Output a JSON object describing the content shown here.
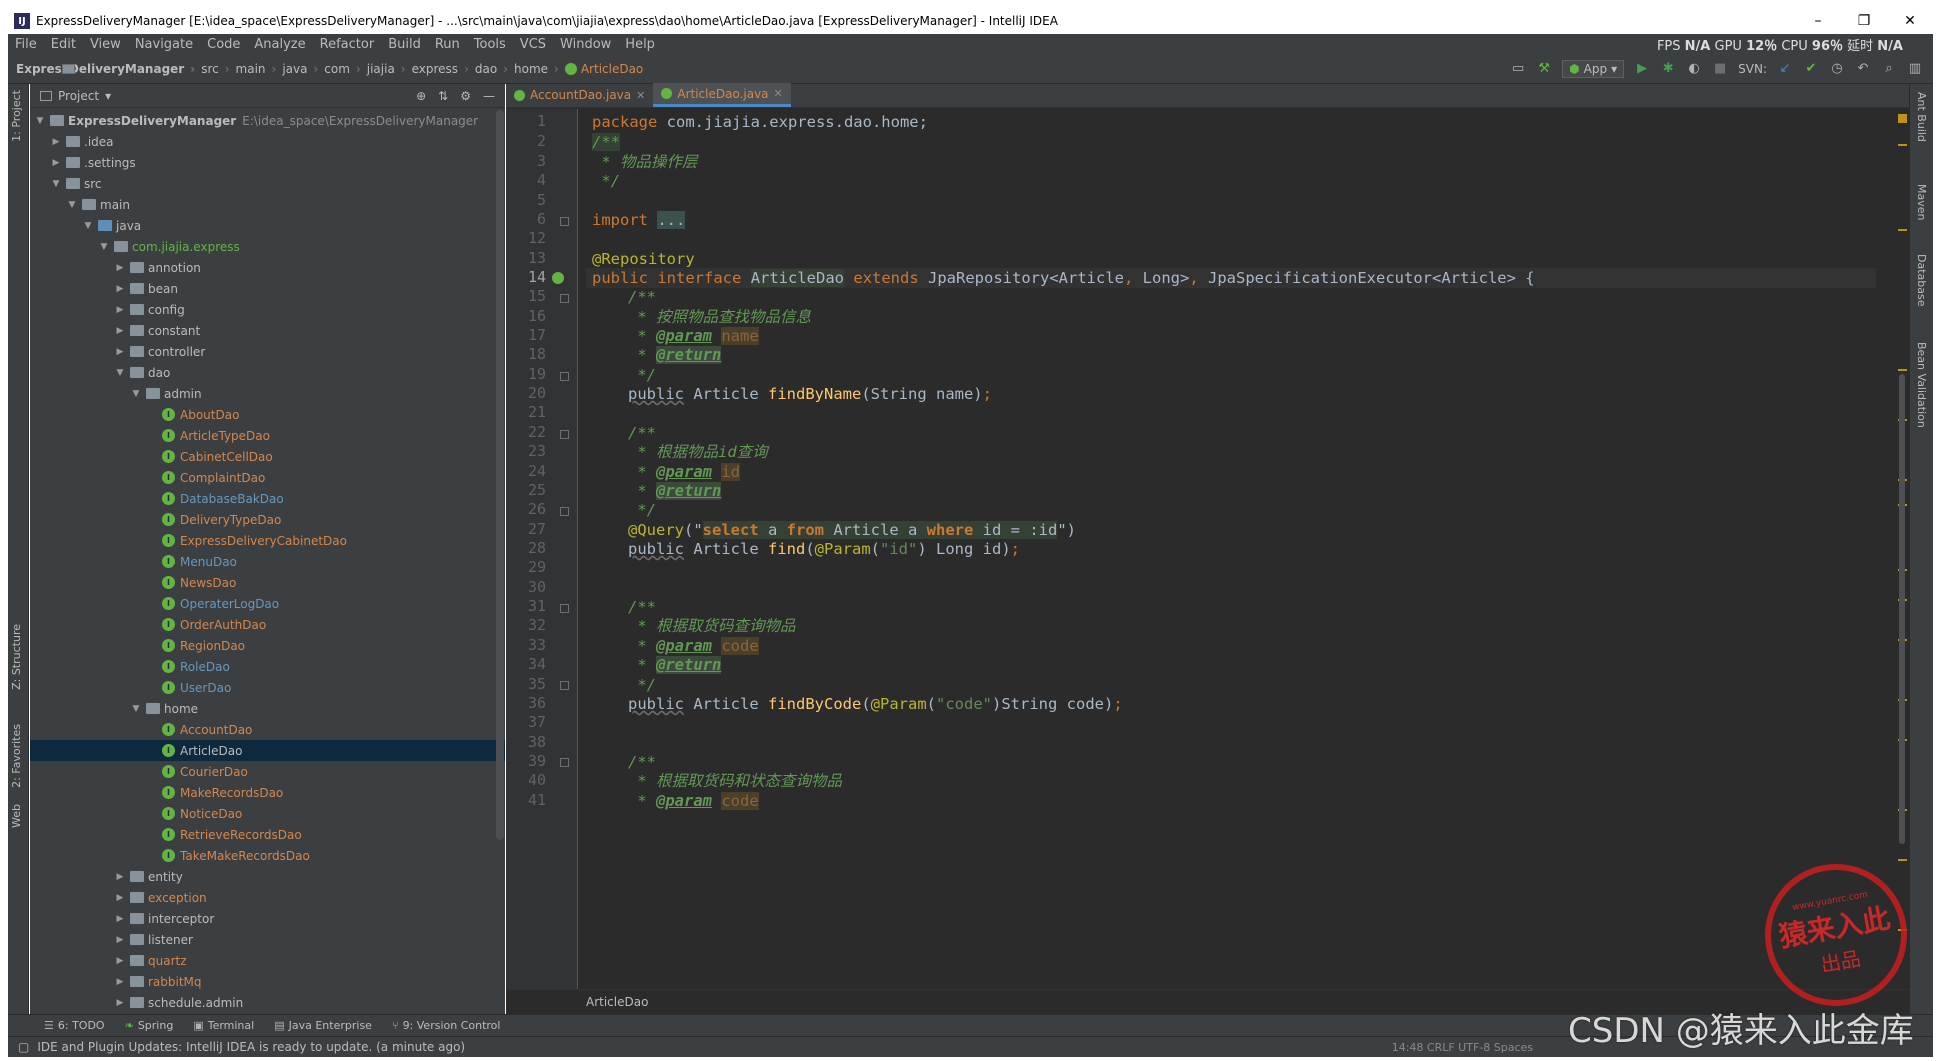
{
  "window": {
    "title": "ExpressDeliveryManager [E:\\idea_space\\ExpressDeliveryManager] - ...\\src\\main\\java\\com\\jiajia\\express\\dao\\home\\ArticleDao.java [ExpressDeliveryManager] - IntelliJ IDEA",
    "minimize": "–",
    "maximize": "❐",
    "close": "✕"
  },
  "menu": {
    "items": [
      "File",
      "Edit",
      "View",
      "Navigate",
      "Code",
      "Analyze",
      "Refactor",
      "Build",
      "Run",
      "Tools",
      "VCS",
      "Window",
      "Help"
    ],
    "perf": {
      "fps_label": "FPS",
      "fps": "N/A",
      "gpu_label": "GPU",
      "gpu": "12％",
      "cpu_label": "CPU",
      "cpu": "96％",
      "lat_label": "延时",
      "lat": "N/A"
    }
  },
  "breadcrumb": {
    "items": [
      "ExpressDeliveryManager",
      "src",
      "main",
      "java",
      "com",
      "jiajia",
      "express",
      "dao",
      "home"
    ],
    "file": "ArticleDao",
    "run_config": "App",
    "svn_label": "SVN:"
  },
  "left_strip": {
    "project": "1: Project",
    "structure": "Z: Structure",
    "favorites": "2: Favorites",
    "web": "Web"
  },
  "right_strip": {
    "ant": "Ant Build",
    "maven": "Maven",
    "database": "Database",
    "bean": "Bean Validation"
  },
  "project_panel": {
    "title": "Project",
    "root_name": "ExpressDeliveryManager",
    "root_path": "E:\\idea_space\\ExpressDeliveryManager",
    "nodes": {
      "idea": ".idea",
      "settings": ".settings",
      "src": "src",
      "main": "main",
      "java": "java",
      "pkg": "com.jiajia.express",
      "annotion": "annotion",
      "bean": "bean",
      "config": "config",
      "constant": "constant",
      "controller": "controller",
      "dao": "dao",
      "admin": "admin",
      "home": "home",
      "entity": "entity",
      "exception": "exception",
      "interceptor": "interceptor",
      "listener": "listener",
      "quartz": "quartz",
      "rabbitMq": "rabbitMq",
      "schedule": "schedule.admin"
    },
    "admin_classes": [
      {
        "name": "AboutDao",
        "color": "orange"
      },
      {
        "name": "ArticleTypeDao",
        "color": "orange"
      },
      {
        "name": "CabinetCellDao",
        "color": "orange"
      },
      {
        "name": "ComplaintDao",
        "color": "orange"
      },
      {
        "name": "DatabaseBakDao",
        "color": "blue"
      },
      {
        "name": "DeliveryTypeDao",
        "color": "orange"
      },
      {
        "name": "ExpressDeliveryCabinetDao",
        "color": "orange"
      },
      {
        "name": "MenuDao",
        "color": "blue"
      },
      {
        "name": "NewsDao",
        "color": "orange"
      },
      {
        "name": "OperaterLogDao",
        "color": "blue"
      },
      {
        "name": "OrderAuthDao",
        "color": "orange"
      },
      {
        "name": "RegionDao",
        "color": "orange"
      },
      {
        "name": "RoleDao",
        "color": "blue"
      },
      {
        "name": "UserDao",
        "color": "blue"
      }
    ],
    "home_classes": [
      {
        "name": "AccountDao",
        "color": "orange"
      },
      {
        "name": "ArticleDao",
        "color": "selected"
      },
      {
        "name": "CourierDao",
        "color": "orange"
      },
      {
        "name": "MakeRecordsDao",
        "color": "orange"
      },
      {
        "name": "NoticeDao",
        "color": "orange"
      },
      {
        "name": "RetrieveRecordsDao",
        "color": "orange"
      },
      {
        "name": "TakeMakeRecordsDao",
        "color": "orange"
      }
    ]
  },
  "editor": {
    "tabs": [
      {
        "label": "AccountDao.java",
        "active": false
      },
      {
        "label": "ArticleDao.java",
        "active": true
      }
    ],
    "line_numbers": [
      "1",
      "2",
      "3",
      "4",
      "5",
      "6",
      "12",
      "13",
      "14",
      "15",
      "16",
      "17",
      "18",
      "19",
      "20",
      "21",
      "22",
      "23",
      "24",
      "25",
      "26",
      "27",
      "28",
      "29",
      "30",
      "31",
      "32",
      "33",
      "34",
      "35",
      "36",
      "37",
      "38",
      "39",
      "40",
      "41"
    ],
    "current_line": "14",
    "code": {
      "l1_kw": "package",
      "l1_rest": " com.jiajia.express.dao.home;",
      "l2": "/**",
      "l3": " * 物品操作层",
      "l4": " */",
      "l6_kw": "import",
      "l6_fold": "...",
      "l13": "@Repository",
      "l14_public": "public",
      "l14_interface": "interface",
      "l14_name": "ArticleDao",
      "l14_extends": "extends",
      "l14_rest1": " JpaRepository<Article",
      "l14_comma1": ",",
      "l14_rest2": " Long>",
      "l14_comma2": ",",
      "l14_rest3": " JpaSpecificationExecutor<Article> {",
      "l15": "/**",
      "l16": " * 按照物品查找物品信息",
      "star": " * ",
      "param_tag": "@param",
      "return_tag": "@return",
      "p_name": "name",
      "p_id": "id",
      "p_code": "code",
      "close_c": " */",
      "public": "public",
      "l20_type": " Article ",
      "l20_fn": "findByName",
      "l20_rest": "(String name)",
      "semi": ";",
      "l22": "/**",
      "l23": " * 根据物品id查询",
      "l27_an": "@Query",
      "l27_open": "(\"",
      "sql_select": "select",
      "sql_a": " a ",
      "sql_from": "from",
      "sql_article": " Article a ",
      "sql_where": "where",
      "sql_rest": " id = :id",
      "l27_close": "\")",
      "l28_type": " Article ",
      "l28_fn": "find",
      "l28_open": "(",
      "l28_an": "@Param",
      "l28_p": "(",
      "l28_str": "\"id\"",
      "l28_rest": ") Long id)",
      "l31": "/**",
      "l32": " * 根据取货码查询物品",
      "l36_fn": "findByCode",
      "l36_str": "\"code\"",
      "l36_rest": ")String code)",
      "l39": "/**",
      "l40": " * 根据取货码和状态查询物品"
    },
    "bottom_crumb": "ArticleDao"
  },
  "bottom_bar": {
    "todo": "6: TODO",
    "spring": "Spring",
    "terminal": "Terminal",
    "java_ee": "Java Enterprise",
    "vcs": "9: Version Control"
  },
  "status": {
    "message": "IDE and Plugin Updates: IntelliJ IDEA is ready to update. (a minute ago)",
    "position": "14:48  CRLF  UTF-8  Spaces"
  },
  "watermark": "CSDN @猿来入此金库",
  "stamp": {
    "top": "www.yuanrc.com",
    "middle": "猿来入此",
    "bottom": "出品"
  }
}
